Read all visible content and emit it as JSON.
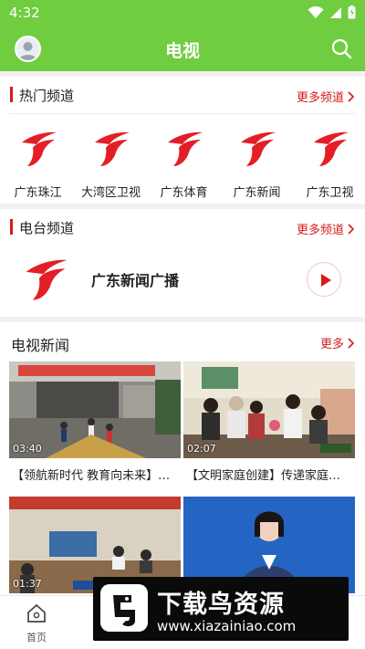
{
  "status_bar": {
    "time": "4:32"
  },
  "app_bar": {
    "title": "电视"
  },
  "hot_channels": {
    "title": "热门频道",
    "more_label": "更多频道",
    "items": [
      {
        "name": "广东珠江"
      },
      {
        "name": "大湾区卫视"
      },
      {
        "name": "广东体育"
      },
      {
        "name": "广东新闻"
      },
      {
        "name": "广东卫视"
      }
    ]
  },
  "radio_channels": {
    "title": "电台频道",
    "more_label": "更多频道",
    "station_name": "广东新闻广播"
  },
  "tv_news": {
    "title": "电视新闻",
    "more_label": "更多",
    "items": [
      {
        "duration": "03:40",
        "caption": "【领航新时代 教育向未来】…"
      },
      {
        "duration": "02:07",
        "caption": "【文明家庭创建】传递家庭…"
      },
      {
        "duration": "01:37",
        "caption": ""
      },
      {
        "duration": "",
        "caption": ""
      }
    ]
  },
  "bottom_nav": {
    "items": [
      {
        "label": "首页"
      }
    ]
  },
  "watermark": {
    "title": "下载鸟资源",
    "url": "www.xiazainiao.com"
  },
  "colors": {
    "brand_green": "#6fcd3f",
    "accent_red": "#d61b1b"
  }
}
